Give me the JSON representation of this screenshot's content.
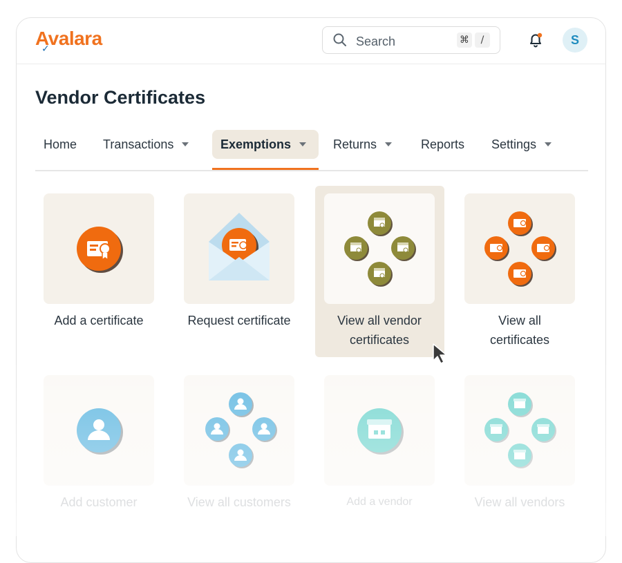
{
  "app": {
    "logo": "Avalara"
  },
  "header": {
    "search": {
      "placeholder": "Search",
      "shortcut_key1": "⌘",
      "shortcut_key2": "/"
    },
    "avatar_initial": "S"
  },
  "page": {
    "title": "Vendor Certificates"
  },
  "nav": {
    "items": [
      {
        "label": "Home"
      },
      {
        "label": "Transactions"
      },
      {
        "label": "Exemptions"
      },
      {
        "label": "Returns"
      },
      {
        "label": "Reports"
      },
      {
        "label": "Settings"
      }
    ],
    "active": "Exemptions"
  },
  "tiles": [
    {
      "label": "Add a certificate",
      "icon": "certificate-icon"
    },
    {
      "label": "Request certificate",
      "icon": "envelope-certificate-icon"
    },
    {
      "label_line1": "View all vendor",
      "label_line2": "certificates",
      "icon": "vendor-certificates-cluster-icon",
      "hovered": true
    },
    {
      "label_line1": "View all",
      "label_line2": "certificates",
      "icon": "certificates-cluster-icon"
    },
    {
      "label": "Add customer",
      "icon": "customer-icon"
    },
    {
      "label": "View all customers",
      "icon": "customers-cluster-icon"
    },
    {
      "label": "Add a vendor",
      "icon": "vendor-icon"
    },
    {
      "label": "View all vendors",
      "icon": "vendors-cluster-icon"
    }
  ],
  "colors": {
    "brand_orange": "#f0721f",
    "brand_blue": "#1a6fb3",
    "olive": "#8e8a3a",
    "sky_blue": "#6cbde3",
    "mint": "#7fd9d3",
    "tile_bg": "#f5f1ea",
    "hover_bg": "#efe9df"
  }
}
